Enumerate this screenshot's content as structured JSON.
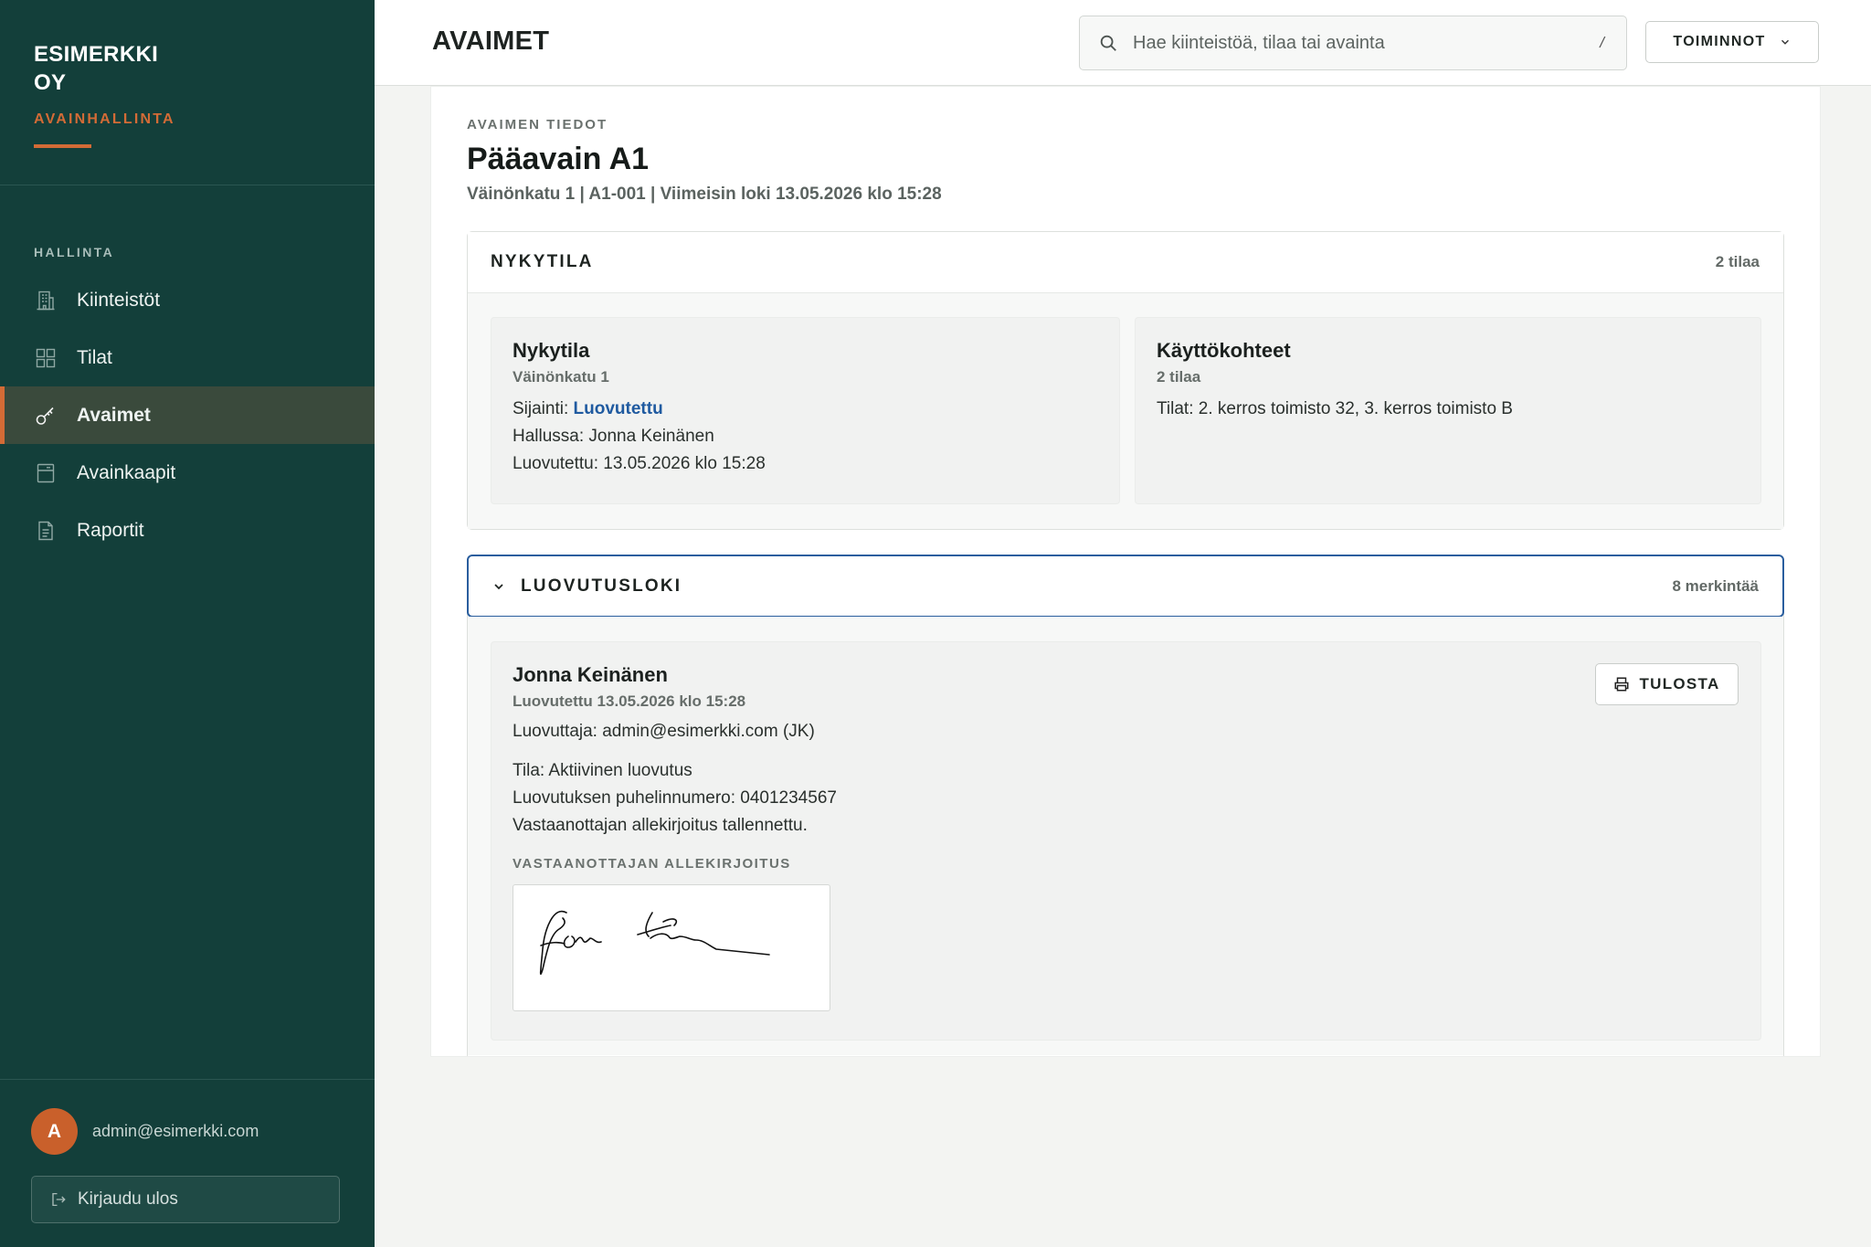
{
  "sidebar": {
    "brand_line1": "ESIMERKKI",
    "brand_line2": "OY",
    "brand_sub": "AVAINHALLINTA",
    "nav_heading": "HALLINTA",
    "items": [
      {
        "label": "Kiinteistöt",
        "icon": "building-icon"
      },
      {
        "label": "Tilat",
        "icon": "grid-icon"
      },
      {
        "label": "Avaimet",
        "icon": "key-icon",
        "active": true
      },
      {
        "label": "Avainkaapit",
        "icon": "cabinet-icon"
      },
      {
        "label": "Raportit",
        "icon": "document-icon"
      }
    ],
    "user": {
      "initial": "A",
      "email": "admin@esimerkki.com"
    },
    "logout_label": "Kirjaudu ulos"
  },
  "header": {
    "title": "AVAIMET",
    "search_placeholder": "Hae kiinteistöä, tilaa tai avainta",
    "search_shortcut": "/",
    "actions_label": "TOIMINNOT"
  },
  "key": {
    "eyebrow": "AVAIMEN TIEDOT",
    "title": "Pääavain A1",
    "meta": "Väinönkatu 1 | A1-001 | Viimeisin loki 13.05.2026 klo 15:28"
  },
  "status_panel": {
    "title": "NYKYTILA",
    "count": "2 tilaa",
    "current": {
      "title": "Nykytila",
      "subtitle": "Väinönkatu 1",
      "location_label": "Sijainti: ",
      "location_value": "Luovutettu",
      "holder": "Hallussa: Jonna Keinänen",
      "handed_over": "Luovutettu: 13.05.2026 klo 15:28"
    },
    "usage": {
      "title": "Käyttökohteet",
      "subtitle": "2 tilaa",
      "spaces": "Tilat: 2. kerros toimisto 32, 3. kerros toimisto B"
    }
  },
  "log_panel": {
    "title": "LUOVUTUSLOKI",
    "count": "8 merkintää",
    "entry": {
      "name": "Jonna Keinänen",
      "date": "Luovutettu 13.05.2026 klo 15:28",
      "handed_by": "Luovuttaja: admin@esimerkki.com (JK)",
      "status": "Tila: Aktiivinen luovutus",
      "phone": "Luovutuksen puhelinnumero: 0401234567",
      "signature_saved": "Vastaanottajan allekirjoitus tallennettu.",
      "signature_label": "VASTAANOTTAJAN ALLEKIRJOITUS",
      "print_label": "TULOSTA"
    }
  },
  "colors": {
    "sidebar_bg": "#133f3a",
    "accent": "#d36b36",
    "active_nav_bg": "#3a4a3c",
    "link": "#1f5aa0",
    "focus_border": "#2a5e9e"
  }
}
